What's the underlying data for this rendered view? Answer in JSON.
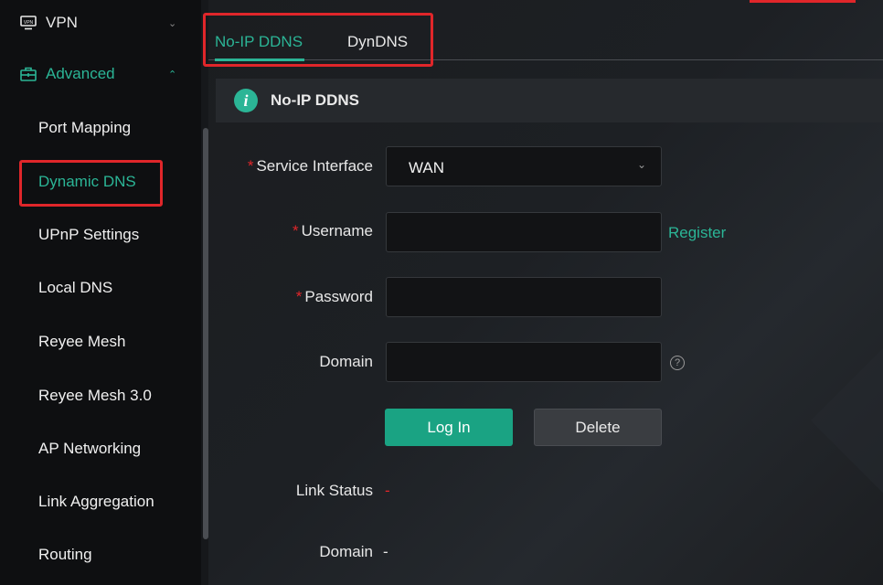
{
  "sidebar": {
    "groups": [
      {
        "label": "VPN",
        "icon": "vpn-icon"
      },
      {
        "label": "Advanced",
        "icon": "toolbox-icon"
      }
    ],
    "items": [
      {
        "label": "Port Mapping"
      },
      {
        "label": "Dynamic DNS",
        "active": true
      },
      {
        "label": "UPnP Settings"
      },
      {
        "label": "Local DNS"
      },
      {
        "label": "Reyee Mesh"
      },
      {
        "label": "Reyee Mesh 3.0"
      },
      {
        "label": "AP Networking"
      },
      {
        "label": "Link Aggregation"
      },
      {
        "label": "Routing"
      }
    ]
  },
  "tabs": [
    {
      "label": "No-IP DDNS",
      "active": true
    },
    {
      "label": "DynDNS"
    }
  ],
  "section": {
    "title": "No-IP DDNS",
    "icon": "info-icon"
  },
  "form": {
    "service_interface": {
      "label": "Service Interface",
      "value": "WAN"
    },
    "username": {
      "label": "Username",
      "value": "",
      "link": "Register"
    },
    "password": {
      "label": "Password",
      "value": ""
    },
    "domain": {
      "label": "Domain",
      "value": ""
    },
    "required_mark": "*",
    "help_glyph": "?"
  },
  "buttons": {
    "login": "Log In",
    "delete": "Delete"
  },
  "status": {
    "link_status": {
      "label": "Link Status",
      "value": "-"
    },
    "domain": {
      "label": "Domain",
      "value": "-"
    }
  },
  "colors": {
    "accent": "#2bb596",
    "highlight_box": "#e0262a",
    "background": "#16181b"
  }
}
